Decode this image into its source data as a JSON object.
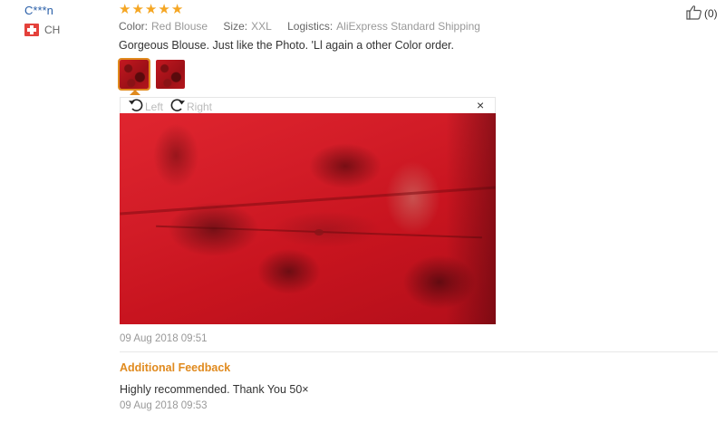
{
  "reviewer": {
    "name": "C***n",
    "country_code": "CH",
    "flag_icon": "swiss-flag-icon"
  },
  "rating": {
    "stars": 5,
    "max": 5,
    "star_icon": "star-icon",
    "color": "#f5a623"
  },
  "helpful": {
    "icon": "thumbs-up-icon",
    "count": "(0)"
  },
  "meta": {
    "color_label": "Color:",
    "color_value": "Red Blouse",
    "size_label": "Size:",
    "size_value": "XXL",
    "logistics_label": "Logistics:",
    "logistics_value": "AliExpress Standard Shipping"
  },
  "review_text": "Gorgeous Blouse. Just like the Photo. 'Ll again a other Color order.",
  "photos": {
    "count": 2,
    "selected_index": 0,
    "rotate_left_label": "Left",
    "rotate_right_label": "Right",
    "close_label": "×"
  },
  "review_date": "09 Aug 2018 09:51",
  "additional_feedback": {
    "title": "Additional Feedback",
    "text": "Highly recommended. Thank You 50×",
    "date": "09 Aug 2018 09:53"
  },
  "colors": {
    "accent": "#e08a1e",
    "link": "#2a5fa8",
    "star": "#f5a623"
  }
}
